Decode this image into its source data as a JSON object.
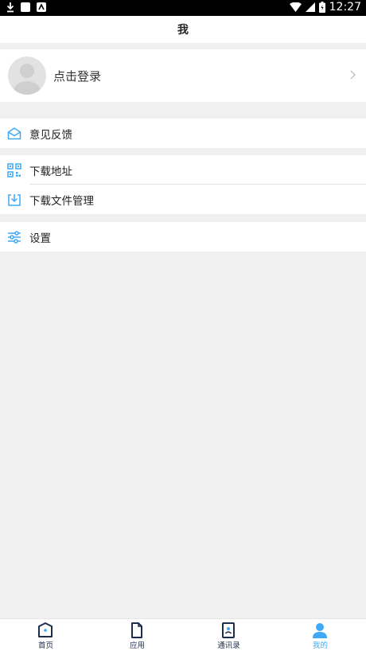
{
  "status_bar": {
    "time": "12:27"
  },
  "header": {
    "title": "我"
  },
  "profile": {
    "login_label": "点击登录"
  },
  "menu": {
    "feedback": "意见反馈",
    "download_address": "下载地址",
    "download_manager": "下载文件管理",
    "settings": "设置"
  },
  "tabs": [
    {
      "label": "首页",
      "icon": "home-icon"
    },
    {
      "label": "应用",
      "icon": "document-icon"
    },
    {
      "label": "通讯录",
      "icon": "contacts-icon"
    },
    {
      "label": "我的",
      "icon": "person-icon"
    }
  ],
  "colors": {
    "accent": "#3fa9f5",
    "tab_inactive": "#1f2d4d",
    "background": "#f0f0f0"
  }
}
